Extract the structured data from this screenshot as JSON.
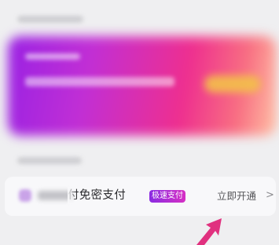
{
  "row": {
    "label": "付免密支付",
    "badge": "极速支付",
    "action": "立即开通",
    "chevron": ">"
  },
  "colors": {
    "badge_gradient_start": "#8a2be2",
    "badge_gradient_end": "#d62fc4",
    "arrow": "#e0317f"
  },
  "icons": {
    "row_icon": "payment-app-icon",
    "chevron": "chevron-right-icon",
    "arrow": "pointer-arrow-icon"
  }
}
